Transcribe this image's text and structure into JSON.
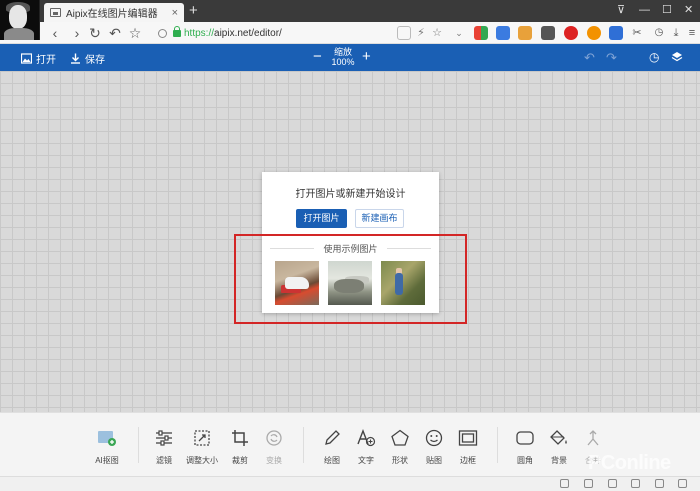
{
  "browser": {
    "tab_title": "Aipix在线图片编辑器",
    "tab_close": "×",
    "new_tab": "+",
    "url_scheme": "https://",
    "url_rest": "aipix.net/editor/",
    "window_controls": [
      "⊽",
      "—",
      "☐",
      "✕"
    ]
  },
  "toolbar": {
    "open_label": "打开",
    "save_label": "保存",
    "zoom_label": "缩放",
    "zoom_value": "100%",
    "zoom_out": "−",
    "zoom_in": "+"
  },
  "start_card": {
    "heading": "打开图片或新建开始设计",
    "open_image": "打开图片",
    "new_canvas": "新建画布",
    "sample_label": "使用示例图片"
  },
  "tools": [
    {
      "label": "AI抠图",
      "icon": "ai-cutout-icon"
    },
    {
      "label": "滤镜",
      "icon": "filter-sliders-icon"
    },
    {
      "label": "调整大小",
      "icon": "resize-icon"
    },
    {
      "label": "裁剪",
      "icon": "crop-icon"
    },
    {
      "label": "变换",
      "icon": "transform-icon"
    },
    {
      "label": "绘图",
      "icon": "pencil-icon"
    },
    {
      "label": "文字",
      "icon": "text-icon"
    },
    {
      "label": "形状",
      "icon": "shape-icon"
    },
    {
      "label": "贴图",
      "icon": "sticker-icon"
    },
    {
      "label": "边框",
      "icon": "frame-icon"
    },
    {
      "label": "圆角",
      "icon": "rounded-corner-icon"
    },
    {
      "label": "背景",
      "icon": "paint-bucket-icon"
    },
    {
      "label": "合并",
      "icon": "merge-icon"
    }
  ],
  "watermark": "PConline",
  "colors": {
    "brand_blue": "#1a5fb4",
    "highlight_red": "#d32626"
  }
}
